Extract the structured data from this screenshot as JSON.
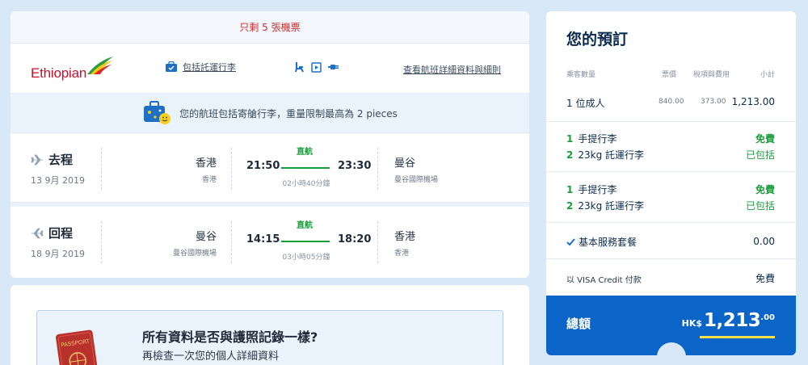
{
  "flight": {
    "seats_left": "只剩 5 張機票",
    "airline": {
      "name": "Ethiopian"
    },
    "bag_link": "包括託運行李",
    "details_link": "查看航班詳細資料與細則",
    "baggage_notice": "您的航班包括寄艙行李，重量限制最高為 2 pieces",
    "legs": [
      {
        "title": "去程",
        "date": "13 9月 2019",
        "from_city": "香港",
        "from_airport": "香港",
        "dep_time": "21:50",
        "arr_time": "23:30",
        "stops": "直航",
        "duration": "02小時40分鐘",
        "to_city": "曼谷",
        "to_airport": "曼谷國際機場"
      },
      {
        "title": "回程",
        "date": "18 9月 2019",
        "from_city": "曼谷",
        "from_airport": "曼谷國際機場",
        "dep_time": "14:15",
        "arr_time": "18:20",
        "stops": "直航",
        "duration": "03小時05分鐘",
        "to_city": "香港",
        "to_airport": "香港"
      }
    ]
  },
  "passport": {
    "title": "所有資料是否與護照記錄一樣?",
    "subtitle": "再檢查一次您的個人詳細資料"
  },
  "booking": {
    "title": "您的預訂",
    "headers": {
      "passengers": "乘客數量",
      "fare": "票價",
      "tax": "稅項與費用",
      "subtotal": "小計"
    },
    "adult": {
      "label": "1 位成人",
      "fare": "840.00",
      "tax": "373.00",
      "subtotal": "1,213.00"
    },
    "baggage_sets": [
      {
        "hand_qty": "1",
        "hand_label": "手提行李",
        "hand_price": "免費",
        "checked_qty": "2",
        "checked_label": "23kg 託運行李",
        "checked_price": "已包括"
      },
      {
        "hand_qty": "1",
        "hand_label": "手提行李",
        "hand_price": "免費",
        "checked_qty": "2",
        "checked_label": "23kg 託運行李",
        "checked_price": "已包括"
      }
    ],
    "service": {
      "label": "基本服務套餐",
      "price": "0.00"
    },
    "payment": {
      "label": "以 VISA Credit 付款",
      "price": "免費"
    },
    "total": {
      "label": "總額",
      "currency": "HK$",
      "amount": "1,213",
      "decimals": ".00"
    }
  },
  "colors": {
    "accent": "#0b64c8",
    "green": "#1a9d3b",
    "red": "#d02a2a",
    "highlight": "#f5e04a"
  }
}
